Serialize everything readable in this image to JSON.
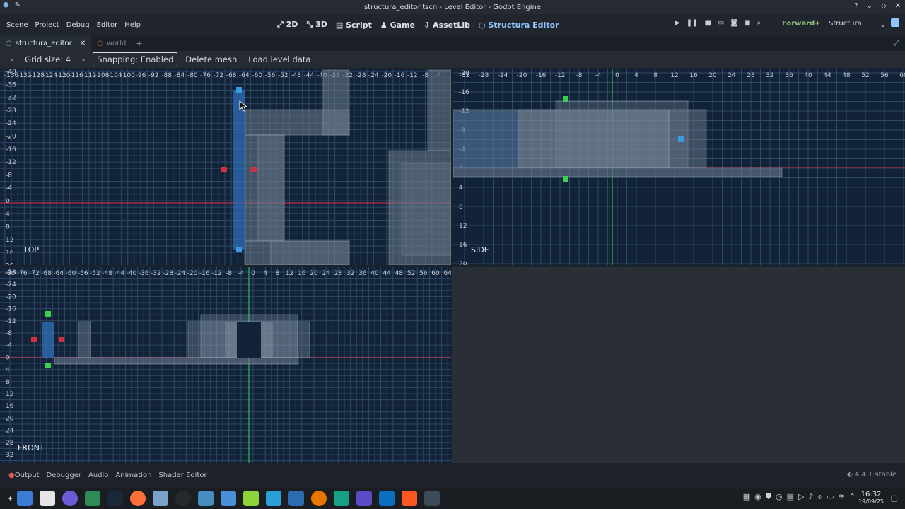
{
  "window": {
    "title": "structura_editor.tscn - Level Editor - Godot Engine"
  },
  "menu": {
    "items": [
      "Scene",
      "Project",
      "Debug",
      "Editor",
      "Help"
    ]
  },
  "main_screens": [
    {
      "label": "2D",
      "icon": "2d-icon"
    },
    {
      "label": "3D",
      "icon": "3d-icon"
    },
    {
      "label": "Script",
      "icon": "script-icon"
    },
    {
      "label": "Game",
      "icon": "game-icon"
    },
    {
      "label": "AssetLib",
      "icon": "assetlib-icon"
    },
    {
      "label": "Structura Editor",
      "icon": "plugin-icon",
      "active": true
    }
  ],
  "renderer": "Forward+",
  "project": "Structura",
  "tabs": [
    {
      "label": "structura_editor",
      "active": true
    },
    {
      "label": "world",
      "active": false
    }
  ],
  "toolbar": {
    "minus_label": "-",
    "grid_label": "Grid size: 4",
    "minus2_label": "-",
    "snapping_label": "Snapping: Enabled",
    "delete_label": "Delete mesh",
    "load_label": "Load level data"
  },
  "viewports": {
    "top": {
      "label": "TOP",
      "x_ticks": [
        "-136",
        "-132",
        "-128",
        "-124",
        "-120",
        "-116",
        "-112",
        "-108",
        "-104",
        "-100",
        "-96",
        "-92",
        "-88",
        "-84",
        "-80",
        "-76",
        "-72",
        "-68",
        "-64",
        "-60",
        "-56",
        "-52",
        "-48",
        "-44",
        "-40",
        "-36",
        "-32",
        "-28",
        "-24",
        "-20",
        "-16",
        "-12",
        "-8",
        "-4"
      ],
      "y_ticks": [
        "-40",
        "-36",
        "-32",
        "-28",
        "-24",
        "-20",
        "-16",
        "-12",
        "-8",
        "-4",
        "0",
        "4",
        "8",
        "12",
        "16",
        "20"
      ]
    },
    "side": {
      "label": "SIDE",
      "x_ticks": [
        "-32",
        "-28",
        "-24",
        "-20",
        "-16",
        "-12",
        "-8",
        "-4",
        "0",
        "4",
        "8",
        "12",
        "16",
        "20",
        "24",
        "28",
        "32",
        "36",
        "40",
        "44",
        "48",
        "52",
        "56",
        "60"
      ],
      "y_ticks": [
        "-20",
        "-16",
        "-12",
        "-8",
        "-4",
        "0",
        "4",
        "8",
        "12",
        "16",
        "20"
      ]
    },
    "front": {
      "label": "FRONT",
      "x_ticks": [
        "-80",
        "-76",
        "-72",
        "-68",
        "-64",
        "-60",
        "-56",
        "-52",
        "-48",
        "-44",
        "-40",
        "-36",
        "-32",
        "-28",
        "-24",
        "-20",
        "-16",
        "-12",
        "-8",
        "-4",
        "0",
        "4",
        "8",
        "12",
        "16",
        "20",
        "24",
        "28",
        "32",
        "36",
        "40",
        "44",
        "48",
        "52",
        "56",
        "60",
        "64"
      ],
      "y_ticks": [
        "-28",
        "-24",
        "-20",
        "-16",
        "-12",
        "-8",
        "-4",
        "0",
        "4",
        "8",
        "12",
        "16",
        "20",
        "24",
        "28",
        "32"
      ]
    }
  },
  "bottom_panel": {
    "tabs": [
      "Output",
      "Debugger",
      "Audio",
      "Animation",
      "Shader Editor"
    ]
  },
  "version": "4.4.1.stable",
  "taskbar": {
    "time": "16:32",
    "date": "19/09/25"
  },
  "colors": {
    "grid_bg": "#122238",
    "grid_line": "#2e4a63",
    "axis_x": "#e0304a",
    "axis_y": "#33dd55",
    "block_fill": "#6b7b8d",
    "selected": "#2f6db5",
    "accent": "#8fc6ff"
  }
}
